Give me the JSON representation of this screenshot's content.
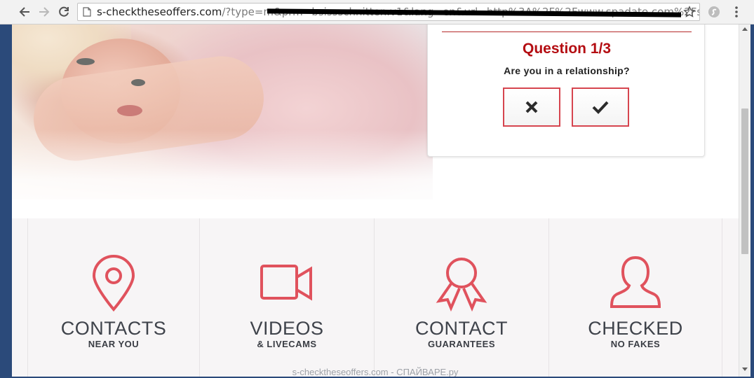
{
  "browser": {
    "url_host": "s-checktheseoffers.com",
    "url_rest": "/?type=m&prm=bsissschnitten.v1&lang=en&url=http%3A%2F%2Fwww.spadate.com%2Fspl%",
    "icons": {
      "back": "arrow-left-icon",
      "forward": "arrow-right-icon",
      "reload": "reload-icon",
      "page": "page-icon",
      "bookmark": "star-icon",
      "extension": "extension-icon",
      "menu": "kebab-menu-icon"
    }
  },
  "question": {
    "title": "Question 1/3",
    "prompt": "Are you in a relationship?",
    "no_icon": "cross-icon",
    "yes_icon": "check-icon"
  },
  "features": [
    {
      "icon": "map-pin-icon",
      "title": "CONTACTS",
      "subtitle": "NEAR YOU"
    },
    {
      "icon": "video-camera-icon",
      "title": "VIDEOS",
      "subtitle": "& LIVECAMS"
    },
    {
      "icon": "award-ribbon-icon",
      "title": "CONTACT",
      "subtitle": "GUARANTEES"
    },
    {
      "icon": "user-silhouette-icon",
      "title": "CHECKED",
      "subtitle": "NO FAKES"
    }
  ],
  "watermark": "s-checktheseoffers.com - СПАЙВАРЕ.ру",
  "colors": {
    "accent": "#e0525d",
    "question_title": "#b40d12",
    "feature_text": "#3f434b"
  }
}
